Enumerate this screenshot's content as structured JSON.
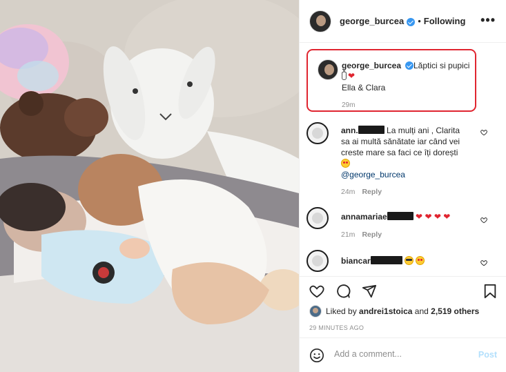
{
  "post": {
    "username": "george_burcea",
    "follow_status": "Following",
    "more_icon": "more-horizontal-icon"
  },
  "caption": {
    "username": "george_burcea",
    "text": "Lăptici si pupici",
    "emojis": [
      "baby-bottle",
      "red-heart"
    ],
    "line2": "Ella & Clara",
    "time": "29m"
  },
  "comments": [
    {
      "username": "ann.",
      "line1": "La mulți ani , Clarita",
      "line2": "sa ai multă sănătate iar când vei",
      "line3": "creste mare sa faci ce îți dorești",
      "mention": "@george_burcea",
      "time": "24m",
      "reply": "Reply"
    },
    {
      "username": "annamariae",
      "time": "21m",
      "reply": "Reply"
    },
    {
      "username": "biancar",
      "time": "",
      "reply": ""
    }
  ],
  "actions": {
    "liked_prefix": "Liked by",
    "liked_user": "andrei1stoica",
    "liked_mid": "and",
    "liked_count": "2,519 others",
    "ago": "29 MINUTES AGO"
  },
  "add_comment": {
    "placeholder": "Add a comment...",
    "post_label": "Post"
  },
  "colors": {
    "highlight_border": "#e0242f",
    "verified": "#3897f0",
    "muted": "#8e8e8e",
    "mention": "#00376b",
    "post_disabled": "#b2dffc"
  }
}
